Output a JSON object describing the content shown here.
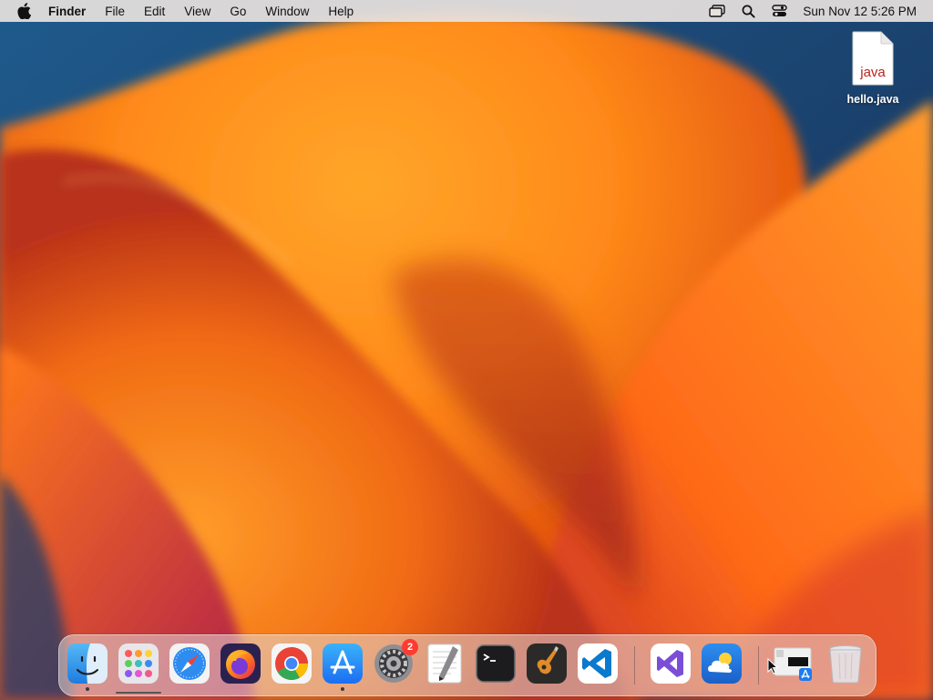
{
  "menubar": {
    "items": [
      {
        "label": "Finder",
        "bold": true
      },
      {
        "label": "File"
      },
      {
        "label": "Edit"
      },
      {
        "label": "View"
      },
      {
        "label": "Go"
      },
      {
        "label": "Window"
      },
      {
        "label": "Help"
      }
    ],
    "status_icons": [
      "screen-mirroring-icon",
      "spotlight-search-icon",
      "control-center-icon"
    ],
    "clock": "Sun Nov 12  5:26 PM"
  },
  "desktop": {
    "file": {
      "name": "hello.java",
      "type_label": "java",
      "icon": "java-file-icon"
    }
  },
  "dock": {
    "apps": [
      {
        "icon": "finder-icon",
        "running": true
      },
      {
        "icon": "launchpad-icon",
        "running": false
      },
      {
        "icon": "safari-icon",
        "running": false
      },
      {
        "icon": "firefox-icon",
        "running": false
      },
      {
        "icon": "chrome-icon",
        "running": false
      },
      {
        "icon": "app-store-icon",
        "running": true
      },
      {
        "icon": "system-settings-icon",
        "running": false,
        "badge": "2"
      },
      {
        "icon": "textedit-icon",
        "running": false
      },
      {
        "icon": "terminal-icon",
        "running": false
      },
      {
        "icon": "garageband-icon",
        "running": false
      },
      {
        "icon": "vscode-icon",
        "running": false
      },
      {
        "icon": "visual-studio-icon",
        "running": false
      },
      {
        "icon": "weather-icon",
        "running": false
      },
      {
        "icon": "app-store-download-icon",
        "running": false
      },
      {
        "icon": "trash-icon",
        "running": false
      }
    ]
  },
  "colors": {
    "wallpaper_blue": "#1d4a7a",
    "wallpaper_orange": "#ff8a1a",
    "badge": "#ff3b30",
    "menubar": "#e8e2de"
  }
}
